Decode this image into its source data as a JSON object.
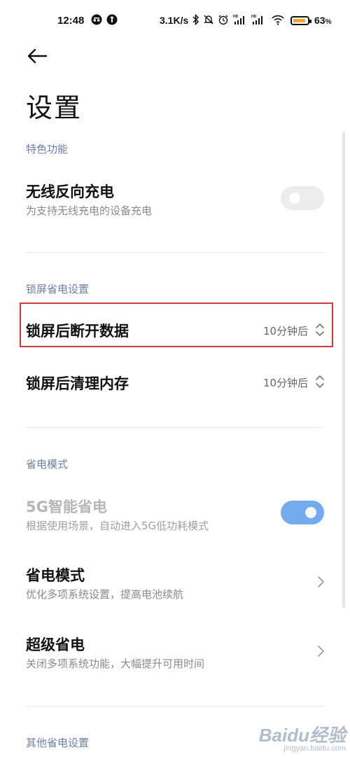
{
  "status_bar": {
    "time": "12:48",
    "net_speed": "3.1K/s",
    "battery_pct": "63",
    "battery_unit": "%",
    "icons": [
      "incognito-icon",
      "app-notification-icon",
      "bluetooth-icon",
      "mute-bell-icon",
      "alarm-icon",
      "signal-hd-icon",
      "signal-hd-icon",
      "wifi-icon",
      "battery-icon"
    ]
  },
  "header": {
    "title": "设置"
  },
  "sections": {
    "features": {
      "label": "特色功能",
      "reverse_charge": {
        "title": "无线反向充电",
        "subtitle": "为支持无线充电的设备充电",
        "toggle_on": false
      }
    },
    "lockscreen": {
      "label": "锁屏省电设置",
      "disconnect_data": {
        "title": "锁屏后断开数据",
        "value": "10分钟后"
      },
      "clear_memory": {
        "title": "锁屏后清理内存",
        "value": "10分钟后"
      }
    },
    "power_mode": {
      "label": "省电模式",
      "smart_5g": {
        "title": "5G智能省电",
        "subtitle": "根据使用场景，自动进入5G低功耗模式",
        "toggle_on": true,
        "disabled": true
      },
      "power_saving": {
        "title": "省电模式",
        "subtitle": "优化多项系统设置，提高电池续航"
      },
      "ultra_saving": {
        "title": "超级省电",
        "subtitle": "关闭多项系统功能，大幅提升可用时间"
      }
    },
    "other": {
      "label": "其他省电设置"
    }
  },
  "watermark": {
    "main": "Baidu经验",
    "sub": "jingyan.baidu.com"
  },
  "colors": {
    "accent": "#5b9dec",
    "section_label": "#6e7fa3",
    "highlight": "#d0393a",
    "battery": "#f5a623"
  }
}
